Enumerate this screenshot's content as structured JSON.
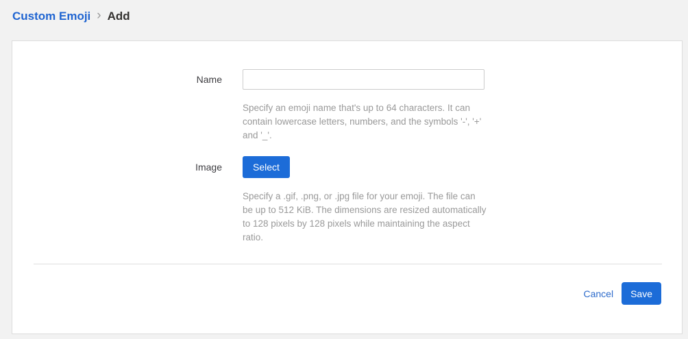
{
  "breadcrumb": {
    "parent_label": "Custom Emoji",
    "separator": "›",
    "current_label": "Add"
  },
  "form": {
    "name": {
      "label": "Name",
      "value": "",
      "help": "Specify an emoji name that's up to 64 characters. It can contain lowercase letters, numbers, and the symbols '-', '+' and '_'."
    },
    "image": {
      "label": "Image",
      "select_button_label": "Select",
      "help": "Specify a .gif, .png, or .jpg file for your emoji. The file can be up to 512 KiB. The dimensions are resized automatically to 128 pixels by 128 pixels while maintaining the aspect ratio."
    }
  },
  "footer": {
    "cancel_label": "Cancel",
    "save_label": "Save"
  },
  "colors": {
    "page_background": "#f2f2f2",
    "card_background": "#ffffff",
    "card_border": "#dcdcdc",
    "button_blue": "#1c6cd8",
    "breadcrumb_link_blue": "#1f64d1",
    "cancel_link_blue": "#2d6bcb",
    "help_text_gray": "#999999",
    "label_text": "#3d3c40"
  }
}
